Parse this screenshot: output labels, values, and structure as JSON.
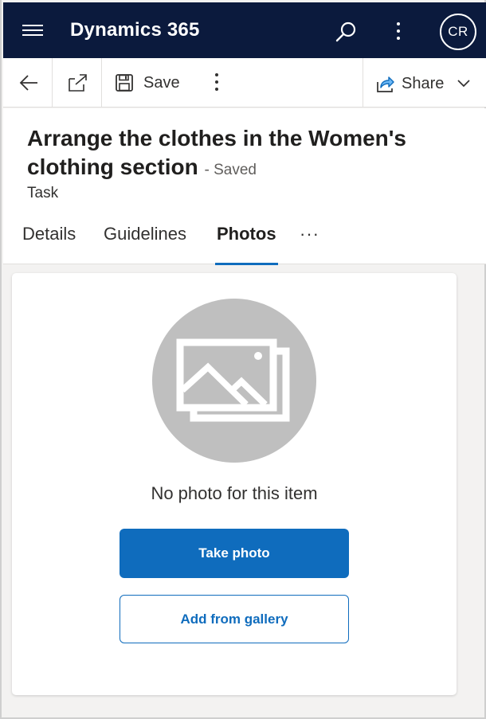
{
  "topbar": {
    "app_title": "Dynamics 365",
    "avatar_initials": "CR",
    "background_color": "#0b1a3d"
  },
  "command_bar": {
    "save_label": "Save",
    "share_label": "Share"
  },
  "record": {
    "title": "Arrange the clothes in the Women's clothing section",
    "save_status": "- Saved",
    "entity_name": "Task"
  },
  "tabs": [
    {
      "label": "Details",
      "active": false
    },
    {
      "label": "Guidelines",
      "active": false
    },
    {
      "label": "Photos",
      "active": true
    }
  ],
  "tabs_overflow": "···",
  "photos": {
    "empty_message": "No photo for this item",
    "take_photo_label": "Take photo",
    "add_from_gallery_label": "Add from gallery"
  },
  "colors": {
    "accent": "#0f6cbd",
    "placeholder_circle": "#bfbfbf"
  }
}
